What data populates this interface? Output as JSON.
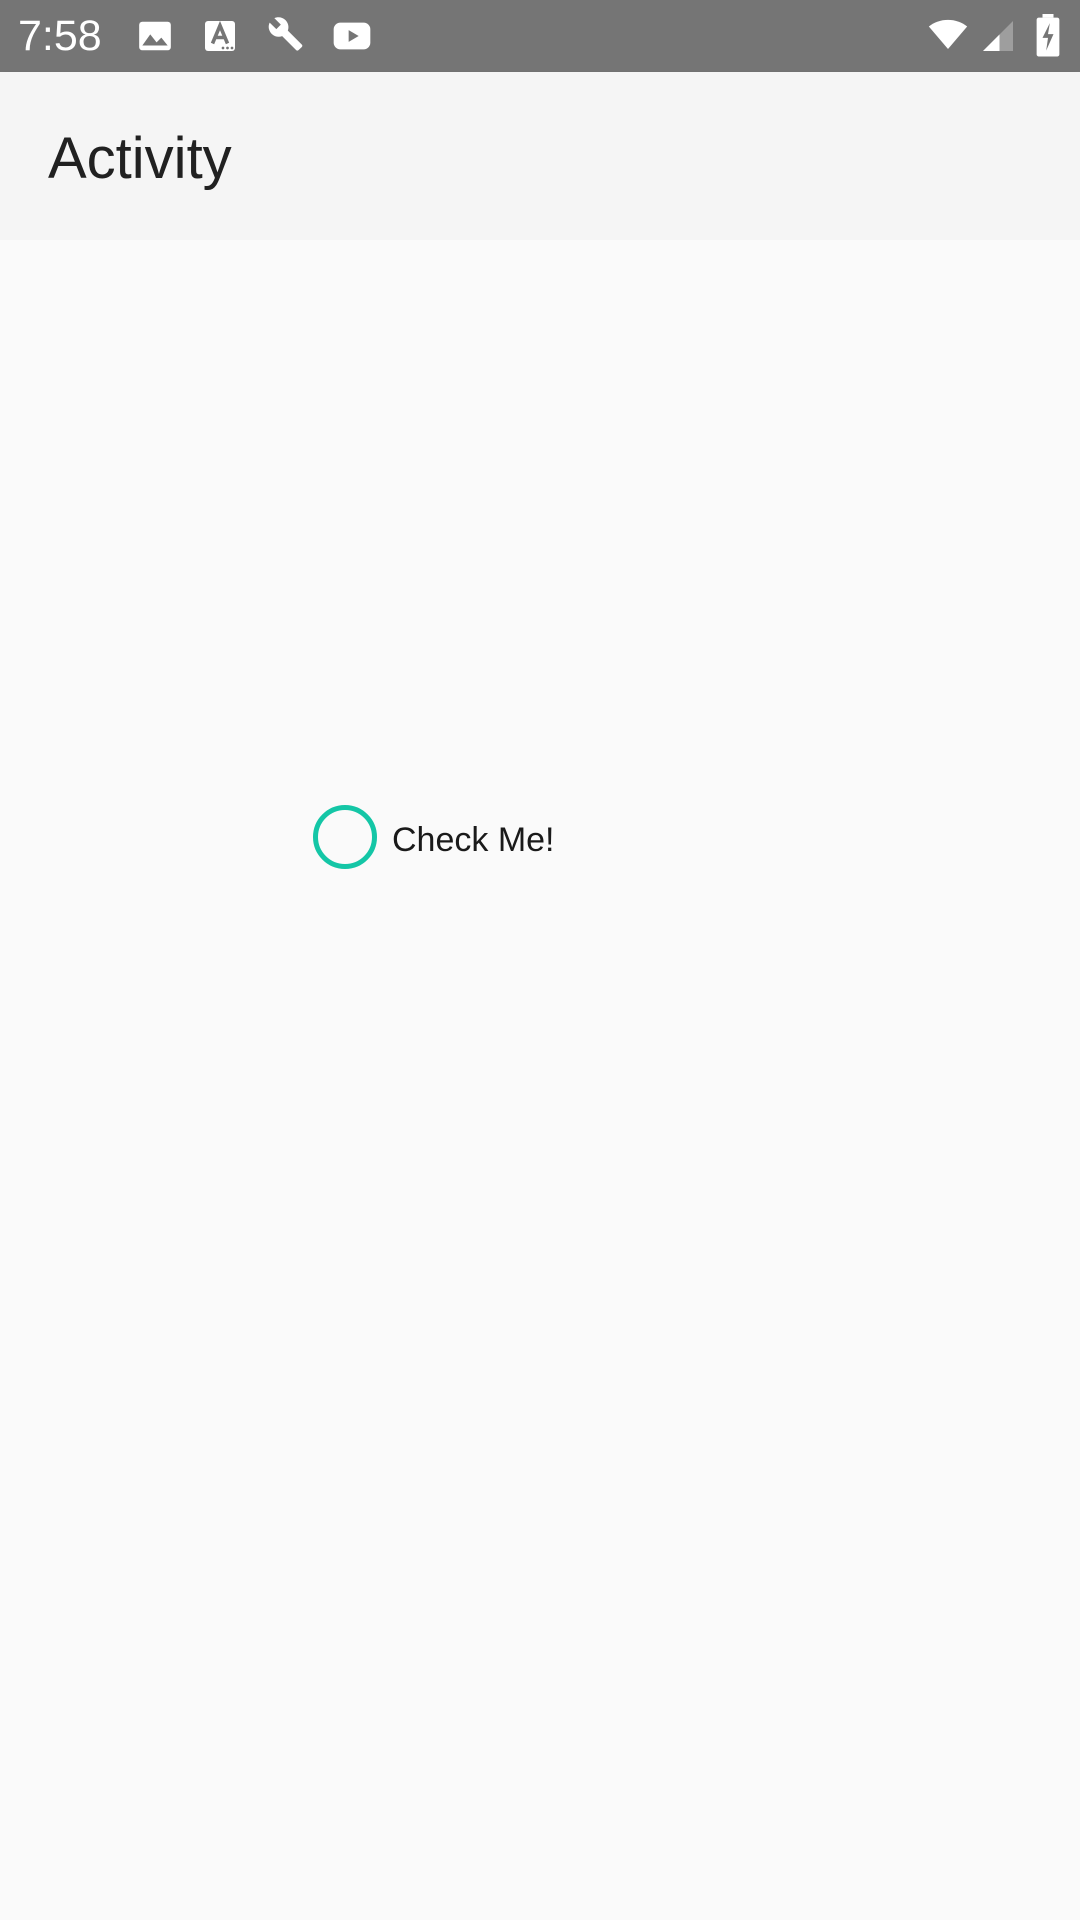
{
  "status_bar": {
    "time": "7:58",
    "notification_icons": [
      "image-icon",
      "text-a-icon",
      "wrench-icon",
      "youtube-icon"
    ],
    "system_icons": [
      "wifi-icon",
      "cellular-signal-icon",
      "battery-charging-icon"
    ]
  },
  "app_bar": {
    "title": "Activity"
  },
  "main": {
    "radio": {
      "label": "Check Me!",
      "checked": false,
      "accent_color": "#14c6a6"
    }
  },
  "colors": {
    "status_bar": "#757575",
    "app_bar": "#f5f5f5",
    "background": "#fafafa",
    "accent": "#14c6a6"
  }
}
